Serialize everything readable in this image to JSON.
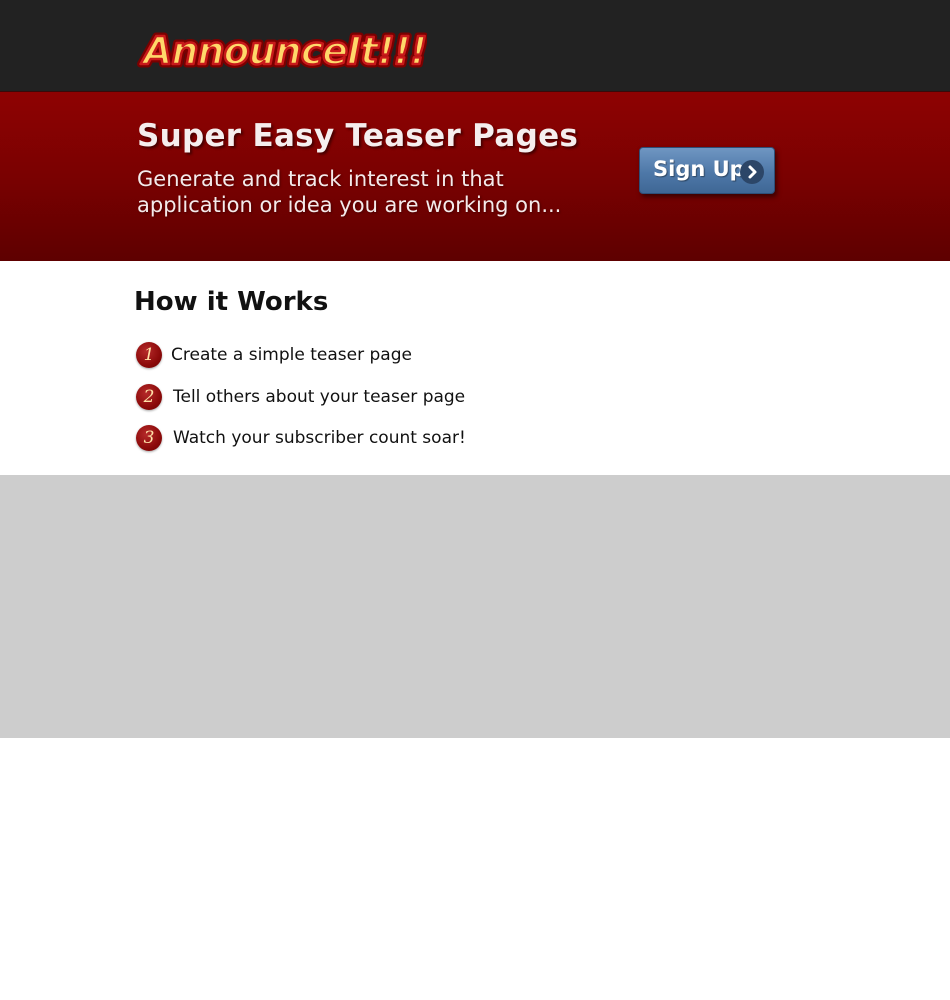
{
  "header": {
    "logo_text": "AnnounceIt!!!"
  },
  "hero": {
    "title": "Super Easy Teaser Pages",
    "subtitle": "Generate and track interest in that application or idea you are working on...",
    "signup_label": "Sign Up",
    "signup_icon": "chevron-right-icon"
  },
  "how_it_works": {
    "title": "How it Works",
    "steps": [
      {
        "number": "1",
        "text": "Create a simple teaser page"
      },
      {
        "number": "2",
        "text": "Tell others about your teaser page"
      },
      {
        "number": "3",
        "text": "Watch your subscriber count soar!"
      }
    ]
  },
  "colors": {
    "topbar": "#222222",
    "hero_red": "#7a0101",
    "button_blue": "#4e78a8",
    "footer_gray": "#cdcdcd"
  }
}
